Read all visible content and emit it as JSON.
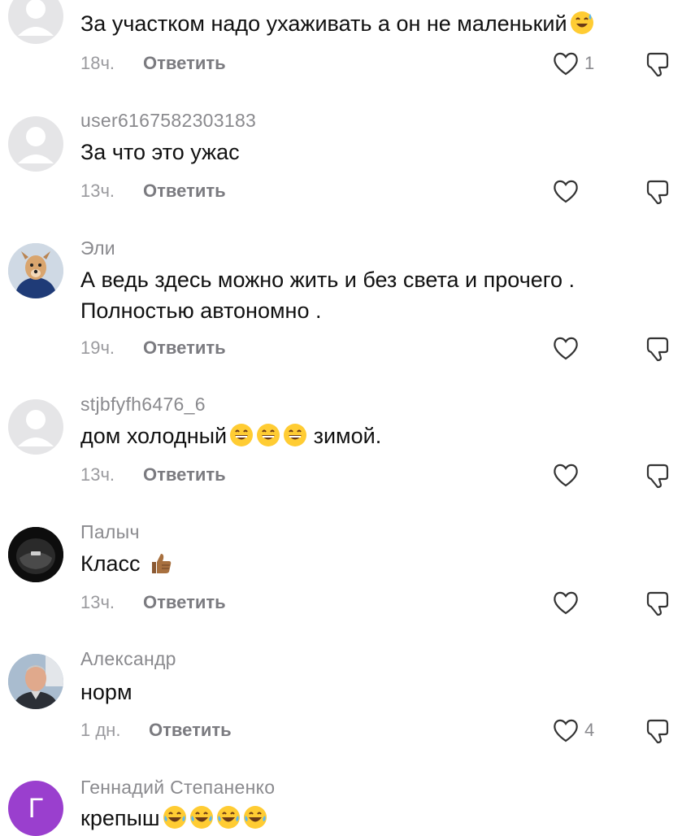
{
  "colors": {
    "avatar_default": "#e5e5e7",
    "avatar_letter_bg": "#9a3fce",
    "text": "#111111",
    "muted": "#8a8a8e"
  },
  "comments": [
    {
      "username": "",
      "text": "За участком надо ухаживать а он не маленький",
      "emoji": "sweat-smile",
      "time": "18ч.",
      "reply": "Ответить",
      "likes": "1",
      "avatar": "default"
    },
    {
      "username": "user6167582303183",
      "text": "За что это ужас",
      "time": "13ч.",
      "reply": "Ответить",
      "likes": "",
      "avatar": "default"
    },
    {
      "username": "Эли",
      "text_line1": "А ведь здесь можно жить и без света и прочего .",
      "text_line2": "Полностью автономно .",
      "time": "19ч.",
      "reply": "Ответить",
      "likes": "",
      "avatar": "dog-photo"
    },
    {
      "username": "stjbfyfh6476_6",
      "text_a": "дом холодный",
      "text_b": " зимой.",
      "time": "13ч.",
      "reply": "Ответить",
      "likes": "",
      "avatar": "default"
    },
    {
      "username": "Палыч",
      "text": "Класс",
      "emoji": "thumbs-up",
      "time": "13ч.",
      "reply": "Ответить",
      "likes": "",
      "avatar": "helmet-photo"
    },
    {
      "username": "Александр",
      "text": "норм",
      "time": "1 дн.",
      "reply": "Ответить",
      "likes": "4",
      "avatar": "person-photo"
    },
    {
      "username": "Геннадий Степаненко",
      "text": "крепыш",
      "avatar_letter": "Г",
      "avatar": "letter"
    }
  ]
}
